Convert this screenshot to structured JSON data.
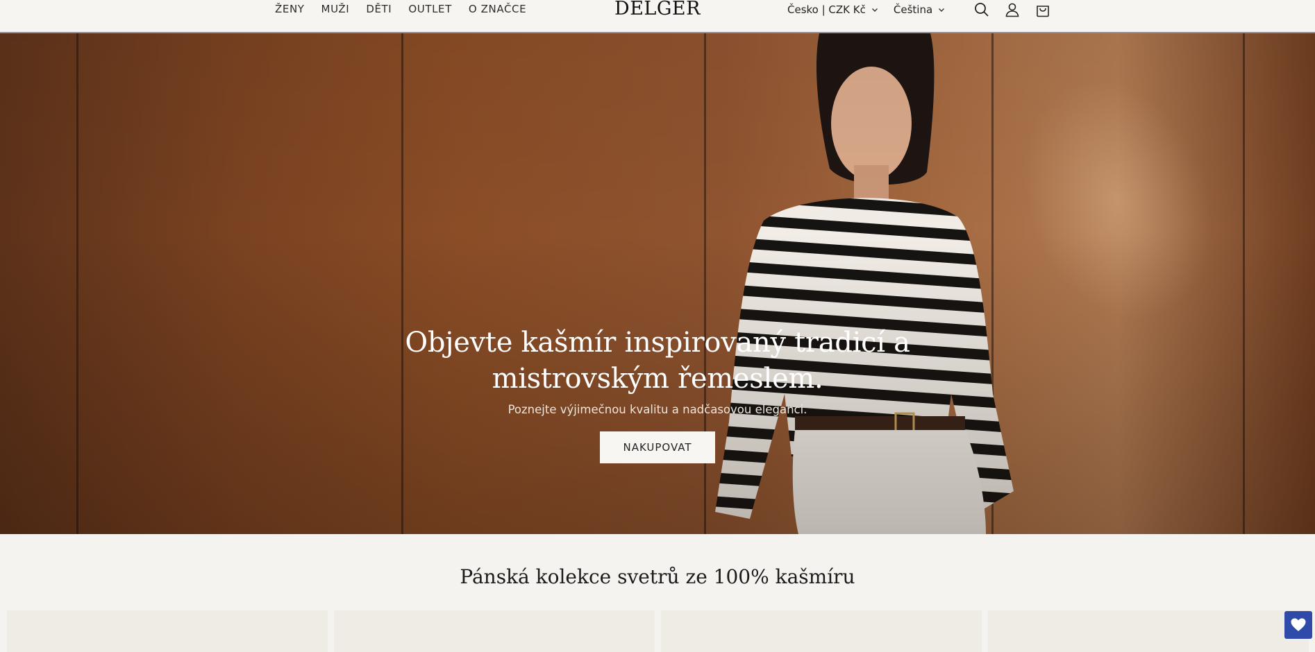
{
  "header": {
    "nav": [
      "ŽENY",
      "MUŽI",
      "DĚTI",
      "OUTLET",
      "O ZNAČCE"
    ],
    "logo": "DELGER",
    "country_selector": "Česko | CZK Kč",
    "language_selector": "Čeština",
    "icons": [
      "search-icon",
      "account-icon",
      "cart-icon",
      "chevron-down-icon"
    ]
  },
  "hero": {
    "title_line1": "Objevte kašmír inspirovaný tradicí a",
    "title_line2": "mistrovským řemeslem.",
    "subtitle": "Poznejte výjimečnou kvalitu a nadčasovou eleganci.",
    "cta": "NAKUPOVAT"
  },
  "collection": {
    "title": "Pánská kolekce svetrů ze 100% kašmíru"
  },
  "wishlist": {
    "icon": "heart-icon"
  },
  "colors": {
    "accent": "#2f4aa8",
    "background": "#f5f3ef"
  }
}
